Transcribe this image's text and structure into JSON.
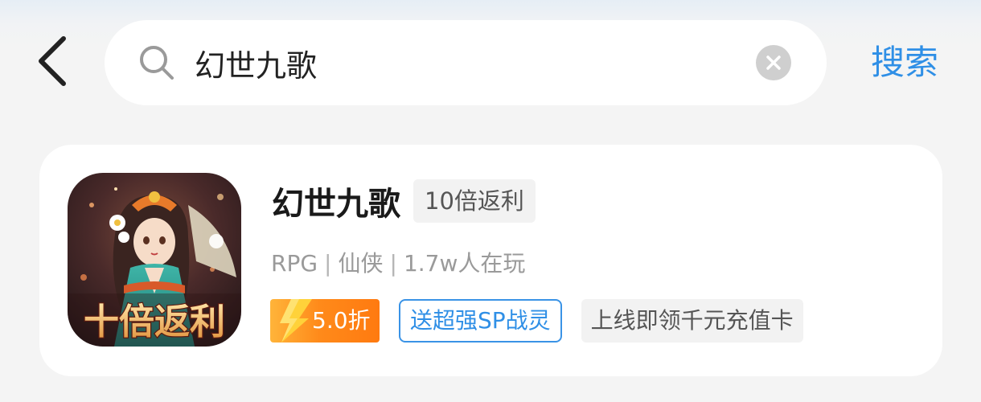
{
  "search": {
    "query": "幻世九歌",
    "action_label": "搜索"
  },
  "result": {
    "title": "幻世九歌",
    "badge": "10倍返利",
    "genre": "RPG",
    "category": "仙侠",
    "players": "1.7w人在玩",
    "separator": "|",
    "discount": "5.0折",
    "tags": [
      "送超强SP战灵",
      "上线即领千元充值卡"
    ],
    "icon_caption": "十倍返利"
  },
  "colors": {
    "accent_blue": "#2f8fe6",
    "discount_orange": "#ff8a1a"
  },
  "icons": [
    "back-arrow-icon",
    "search-icon",
    "clear-icon",
    "lightning-icon"
  ]
}
